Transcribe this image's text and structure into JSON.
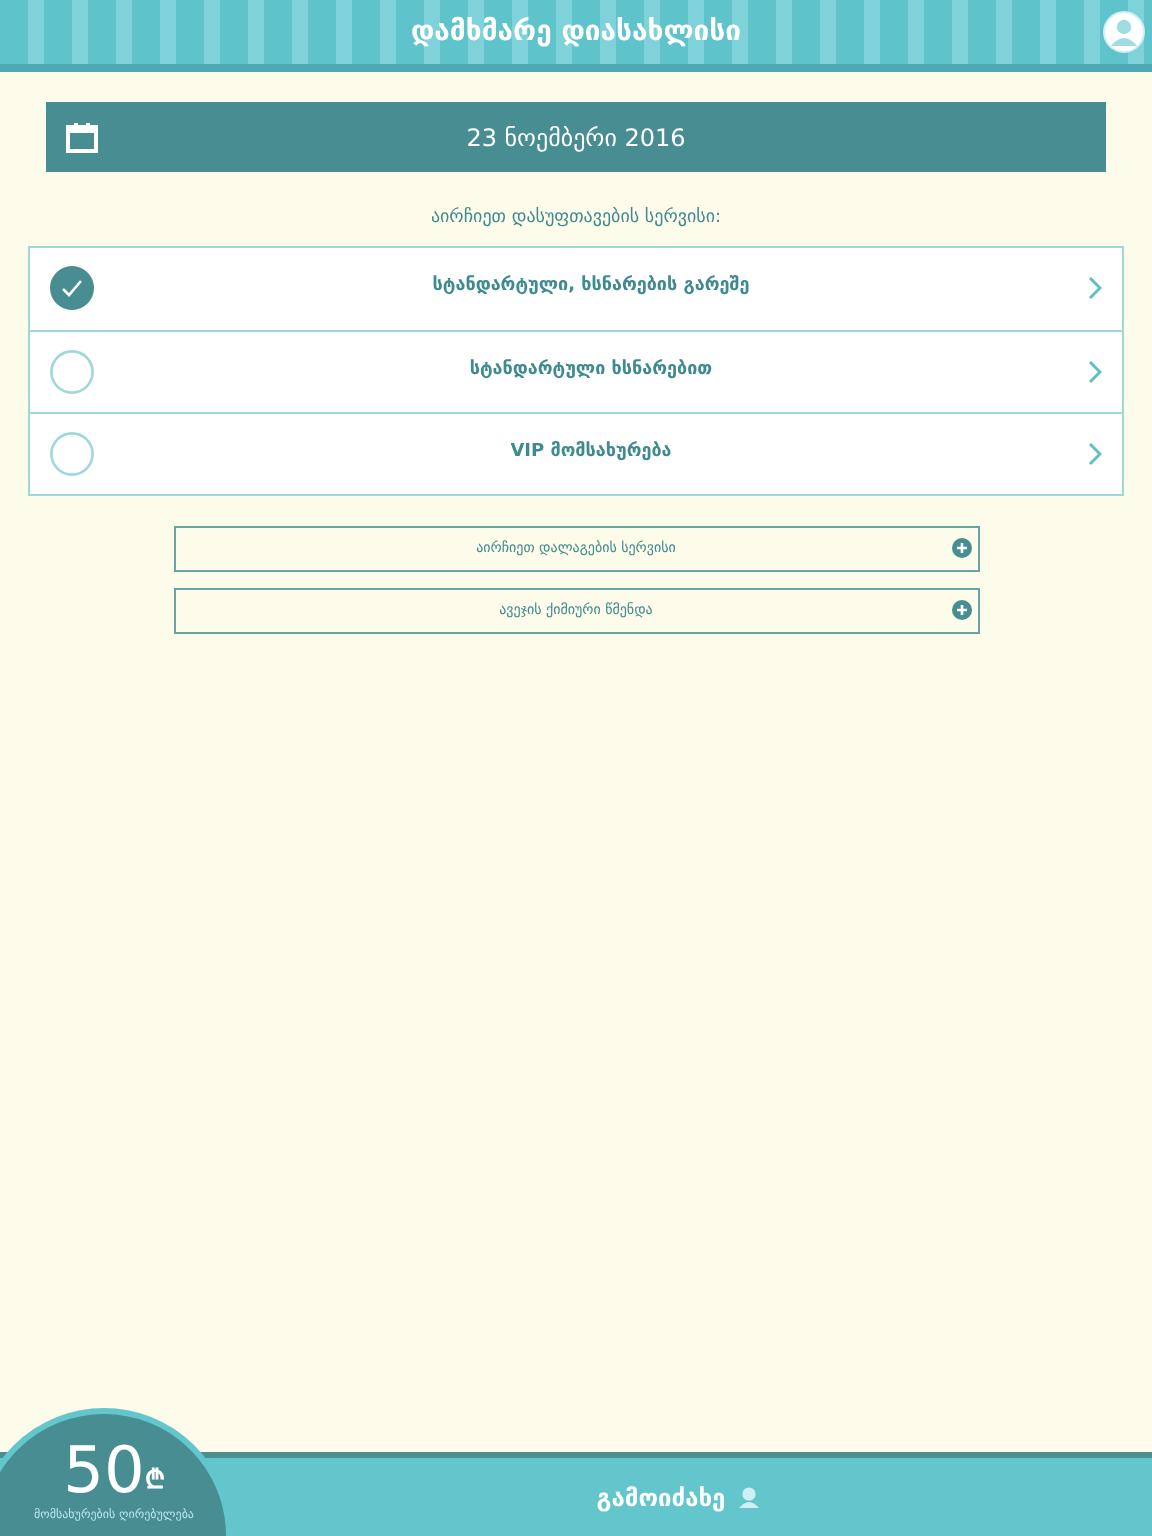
{
  "header": {
    "title": "დამხმარე დიასახლისი"
  },
  "date_bar": {
    "date": "23 ნოემბერი 2016"
  },
  "services": {
    "prompt": "აირჩიეთ დასუფთავების სერვისი:",
    "options": [
      {
        "label": "სტანდარტული, ხსნარების გარეშე",
        "selected": true
      },
      {
        "label": "სტანდარტული ხსნარებით",
        "selected": false
      },
      {
        "label": "VIP მომსახურება",
        "selected": false
      }
    ]
  },
  "extras": [
    {
      "label": "აირჩიეთ დალაგების სერვისი"
    },
    {
      "label": "ავეჯის ქიმიური წმენდა"
    }
  ],
  "footer": {
    "price": "50",
    "currency": "₾",
    "price_label": "მომსახურების ღირებულება",
    "call_button": "გამოიძახე"
  }
}
